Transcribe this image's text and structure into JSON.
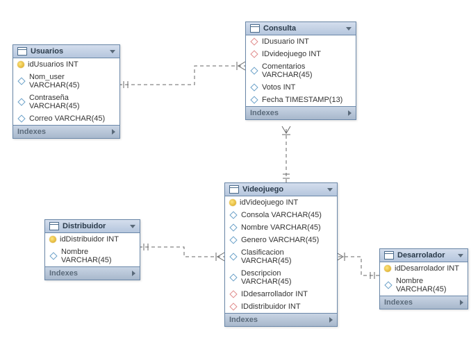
{
  "entities": {
    "usuarios": {
      "title": "Usuarios",
      "indexes_label": "Indexes",
      "columns": [
        {
          "name": "idUsuarios INT",
          "type": "pk"
        },
        {
          "name": "Nom_user VARCHAR(45)",
          "type": "col"
        },
        {
          "name": "Contraseña VARCHAR(45)",
          "type": "col"
        },
        {
          "name": "Correo VARCHAR(45)",
          "type": "col"
        }
      ]
    },
    "consulta": {
      "title": "Consulta",
      "indexes_label": "Indexes",
      "columns": [
        {
          "name": "IDusuario INT",
          "type": "fk"
        },
        {
          "name": "IDvideojuego INT",
          "type": "fk"
        },
        {
          "name": "Comentarios VARCHAR(45)",
          "type": "col"
        },
        {
          "name": "Votos INT",
          "type": "col"
        },
        {
          "name": "Fecha TIMESTAMP(13)",
          "type": "col"
        }
      ]
    },
    "distribuidor": {
      "title": "Distribuidor",
      "indexes_label": "Indexes",
      "columns": [
        {
          "name": "idDistribuidor INT",
          "type": "pk"
        },
        {
          "name": "Nombre VARCHAR(45)",
          "type": "col"
        }
      ]
    },
    "videojuego": {
      "title": "Videojuego",
      "indexes_label": "Indexes",
      "columns": [
        {
          "name": "idVideojuego INT",
          "type": "pk"
        },
        {
          "name": "Consola VARCHAR(45)",
          "type": "col"
        },
        {
          "name": "Nombre VARCHAR(45)",
          "type": "col"
        },
        {
          "name": "Genero VARCHAR(45)",
          "type": "col"
        },
        {
          "name": "Clasificacion VARCHAR(45)",
          "type": "col"
        },
        {
          "name": "Descripcion VARCHAR(45)",
          "type": "col"
        },
        {
          "name": "IDdesarrollador INT",
          "type": "fk"
        },
        {
          "name": "IDdistribuidor INT",
          "type": "fk"
        }
      ]
    },
    "desarrolador": {
      "title": "Desarrolador",
      "indexes_label": "Indexes",
      "columns": [
        {
          "name": "idDesarrolador INT",
          "type": "pk"
        },
        {
          "name": "Nombre VARCHAR(45)",
          "type": "col"
        }
      ]
    }
  },
  "relationships": [
    {
      "from": "Usuarios",
      "to": "Consulta",
      "type": "one-to-many"
    },
    {
      "from": "Videojuego",
      "to": "Consulta",
      "type": "one-to-many"
    },
    {
      "from": "Distribuidor",
      "to": "Videojuego",
      "type": "one-to-many"
    },
    {
      "from": "Desarrolador",
      "to": "Videojuego",
      "type": "one-to-many"
    }
  ]
}
